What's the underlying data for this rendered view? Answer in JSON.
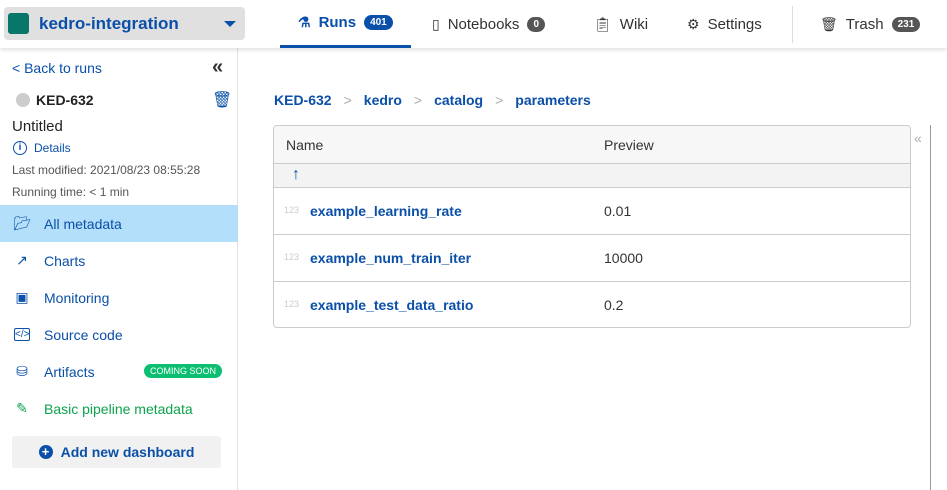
{
  "project": {
    "name": "kedro-integration",
    "color": "#08776a"
  },
  "tabs": [
    {
      "label": "Runs",
      "badge": "401",
      "icon": "flask-icon"
    },
    {
      "label": "Notebooks",
      "badge": "0",
      "icon": "notebook-icon"
    },
    {
      "label": "Wiki",
      "icon": "clipboard-icon"
    },
    {
      "label": "Settings",
      "icon": "gear-icon"
    },
    {
      "label": "Trash",
      "badge": "231",
      "icon": "trash-icon"
    }
  ],
  "sidebar": {
    "back": "< Back to runs",
    "run_id": "KED-632",
    "title": "Untitled",
    "details": "Details",
    "last_modified": "Last modified: 2021/08/23 08:55:28",
    "running_time": "Running time: < 1 min",
    "items": [
      {
        "label": "All metadata"
      },
      {
        "label": "Charts"
      },
      {
        "label": "Monitoring"
      },
      {
        "label": "Source code"
      },
      {
        "label": "Artifacts",
        "badge": "COMING SOON"
      },
      {
        "label": "Basic pipeline metadata"
      }
    ],
    "add_dashboard": "Add new dashboard"
  },
  "breadcrumb": [
    "KED-632",
    "kedro",
    "catalog",
    "parameters"
  ],
  "table": {
    "headers": [
      "Name",
      "Preview"
    ],
    "up": "↑",
    "rows": [
      {
        "type": "123",
        "name": "example_learning_rate",
        "value": "0.01"
      },
      {
        "type": "123",
        "name": "example_num_train_iter",
        "value": "10000"
      },
      {
        "type": "123",
        "name": "example_test_data_ratio",
        "value": "0.2"
      }
    ]
  }
}
